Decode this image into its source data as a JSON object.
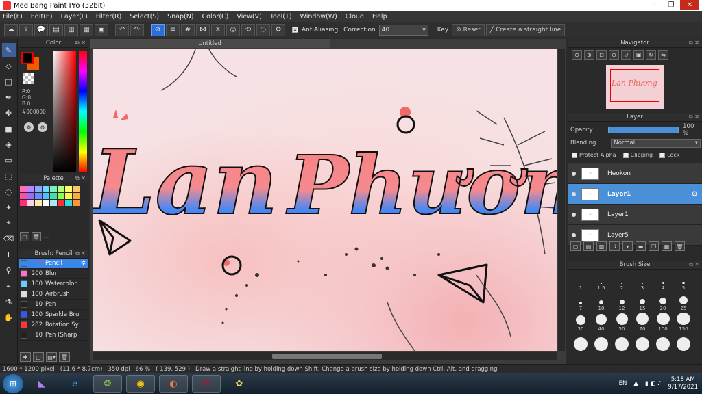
{
  "window": {
    "title": "MediBang Paint Pro (32bit)",
    "controls": [
      "—",
      "❐",
      "✕"
    ]
  },
  "menu": [
    "File(F)",
    "Edit(E)",
    "Layer(L)",
    "Filter(R)",
    "Select(S)",
    "Snap(N)",
    "Color(C)",
    "View(V)",
    "Tool(T)",
    "Window(W)",
    "Cloud",
    "Help"
  ],
  "toolbar": {
    "antialiasing_label": "AntiAliasing",
    "antialiasing_checked": true,
    "correction_label": "Correction",
    "correction_value": "40",
    "key_label": "Key",
    "reset_label": "Reset",
    "straight_line_label": "Create a straight line"
  },
  "color_panel": {
    "title": "Color",
    "r": "R:0",
    "g": "G:0",
    "b": "B:0",
    "hex": "#000000",
    "primary_color": "#000000",
    "secondary_color": "#f25a00"
  },
  "palette": {
    "title": "Palette",
    "more": "---",
    "colors": [
      "#ff6fb5",
      "#b388ff",
      "#8aa8ff",
      "#70d6ff",
      "#7ef0c0",
      "#b4ff7a",
      "#f8ff6a",
      "#ffc56a",
      "#ff4ea0",
      "#9b6bff",
      "#6b8cff",
      "#47c4ff",
      "#3fe2a0",
      "#8eff4a",
      "#fff04a",
      "#ffab3a",
      "#ff2d7a",
      "#ffd1e6",
      "#ffe9a8",
      "#ffffff",
      "#a8e8ff",
      "#ff3030",
      "#33dddd",
      "#ff9933"
    ]
  },
  "brush_panel": {
    "title": "Brush: Pencil",
    "items": [
      {
        "size": "7",
        "name": "Pencil",
        "color": "#3a86e8",
        "selected": true
      },
      {
        "size": "200",
        "name": "Blur",
        "color": "#ff6fcf",
        "selected": false
      },
      {
        "size": "100",
        "name": "Watercolor",
        "color": "#66ccff",
        "selected": false
      },
      {
        "size": "100",
        "name": "Airbrush",
        "color": "#dddddd",
        "selected": false
      },
      {
        "size": "10",
        "name": "Pen",
        "color": "#222222",
        "selected": false
      },
      {
        "size": "100",
        "name": "Sparkle Bru",
        "color": "#3355ff",
        "selected": false
      },
      {
        "size": "282",
        "name": "Rotation Sy",
        "color": "#ff3333",
        "selected": false
      },
      {
        "size": "10",
        "name": "Pen (Sharp",
        "color": "#222222",
        "selected": false
      }
    ]
  },
  "canvas": {
    "tab_title": "Untitled",
    "artwork_text_1": "Lan",
    "artwork_text_2": "Phương"
  },
  "navigator": {
    "title": "Navigator",
    "thumb_text": "Lan Phương"
  },
  "layer_panel": {
    "title": "Layer",
    "opacity_label": "Opacity",
    "opacity_value": "100 %",
    "opacity_fraction": 1.0,
    "blending_label": "Blending",
    "blending_value": "Normal",
    "protect_alpha": "Protect Alpha",
    "clipping": "Clipping",
    "lock": "Lock",
    "layers": [
      {
        "name": "Heokon",
        "selected": false
      },
      {
        "name": "Layer1",
        "selected": true
      },
      {
        "name": "Layer1",
        "selected": false
      },
      {
        "name": "Layer5",
        "selected": false
      }
    ]
  },
  "brush_size_panel": {
    "title": "Brush Size",
    "sizes": [
      "1",
      "1.5",
      "2",
      "3",
      "4",
      "5",
      "7",
      "10",
      "12",
      "15",
      "20",
      "25",
      "30",
      "40",
      "50",
      "70",
      "100",
      "150",
      "",
      "",
      "",
      "",
      "",
      ""
    ]
  },
  "statusbar": {
    "image_size": "1600 * 1200 pixel",
    "print_size": "(11.6 * 8.7cm)",
    "dpi": "350 dpi",
    "zoom": "66 %",
    "cursor": "( 139, 529 )",
    "hint": "Draw a straight line by holding down Shift, Change a brush size by holding down Ctrl, Alt, and dragging"
  },
  "taskbar": {
    "language": "EN",
    "time": "5:18 AM",
    "date": "9/17/2021"
  }
}
